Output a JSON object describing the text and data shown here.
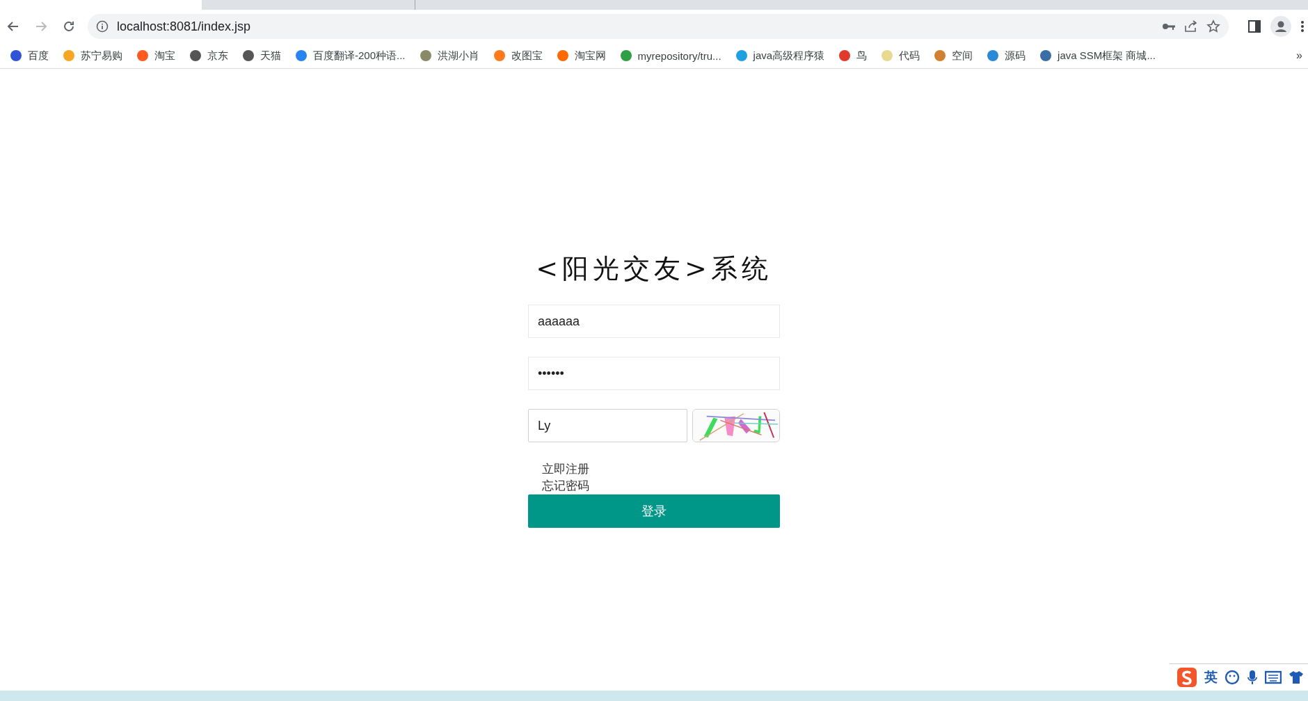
{
  "browser": {
    "tabs": [
      {
        "selected": true
      },
      {
        "selected": false
      }
    ],
    "address": "localhost:8081/index.jsp",
    "bookmarks": [
      {
        "label": "百度",
        "color": "#3054d6"
      },
      {
        "label": "苏宁易购",
        "color": "#f5a623"
      },
      {
        "label": "淘宝",
        "color": "#ff5a1f"
      },
      {
        "label": "京东",
        "color": "#555555"
      },
      {
        "label": "天猫",
        "color": "#555555"
      },
      {
        "label": "百度翻译-200种语...",
        "color": "#2a84f0"
      },
      {
        "label": "洪湖小肖",
        "color": "#8a8a6a"
      },
      {
        "label": "改图宝",
        "color": "#ff7a1a"
      },
      {
        "label": "淘宝网",
        "color": "#ff6a00"
      },
      {
        "label": "myrepository/tru...",
        "color": "#2f9e44"
      },
      {
        "label": "java高级程序猿",
        "color": "#20a0e0"
      },
      {
        "label": "鸟",
        "color": "#e03a2a"
      },
      {
        "label": "代码",
        "color": "#e8d890"
      },
      {
        "label": "空间",
        "color": "#d08030"
      },
      {
        "label": "源码",
        "color": "#2a8ad8"
      },
      {
        "label": "java SSM框架 商城...",
        "color": "#3a6ea5"
      }
    ],
    "more": "»"
  },
  "login": {
    "title": "<阳光交友>系统",
    "username": "aaaaaa",
    "password": "••••••",
    "captcha": "Ly",
    "links": [
      "立即注册",
      "忘记密码"
    ],
    "submit": "登录"
  },
  "ime": {
    "mode": "英"
  }
}
